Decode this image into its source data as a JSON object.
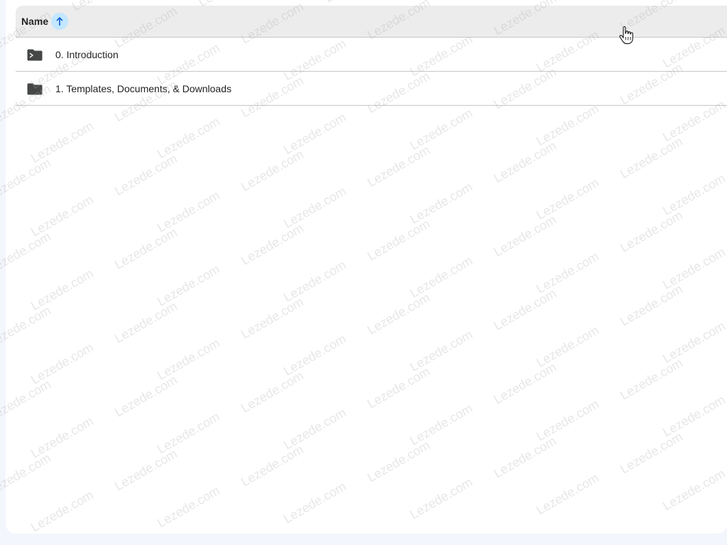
{
  "list": {
    "header": {
      "name_label": "Name",
      "sort_icon": "arrow-up-icon",
      "sort_active_color": "#c2e7ff"
    },
    "rows": [
      {
        "label": "0. Introduction",
        "icon": "folder-icon"
      },
      {
        "label": "1. Templates, Documents, & Downloads",
        "icon": "folder-icon"
      }
    ]
  },
  "watermark": {
    "text": "Lezede.com"
  },
  "colors": {
    "header_bg": "#ececec",
    "divider": "#c7c7c7",
    "folder": "#444746"
  }
}
